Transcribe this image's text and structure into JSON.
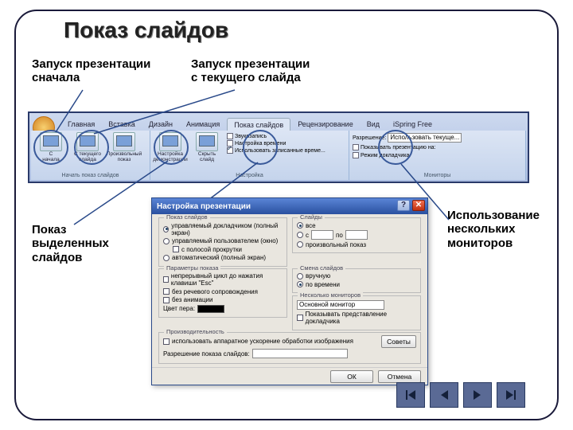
{
  "title": "Показ слайдов",
  "annotations": {
    "start_begin": "Запуск презентации\nсначала",
    "start_current": "Запуск презентации\nс текущего слайда",
    "custom_show": "Показ\nвыделенных\nслайдов",
    "monitors": "Использование\nнескольких\nмониторов"
  },
  "ribbon": {
    "tabs": [
      "Главная",
      "Вставка",
      "Дизайн",
      "Анимация",
      "Показ слайдов",
      "Рецензирование",
      "Вид",
      "iSpring Free"
    ],
    "active_tab": "Показ слайдов",
    "g_start_label": "Начать показ слайдов",
    "items_start": [
      {
        "label": "С\nначала"
      },
      {
        "label": "С текущего\nслайда"
      },
      {
        "label": "Произвольный\nпоказ"
      }
    ],
    "g_setup_label": "Настройка",
    "items_setup": [
      {
        "label": "Настройка\nдемонстрации"
      },
      {
        "label": "Скрыть\nслайд"
      }
    ],
    "opts_setup": [
      "Звукозапись",
      "Настройка времени",
      "Использовать записанные време..."
    ],
    "g_monitors_label": "Мониторы",
    "mon_res_label": "Разрешение:",
    "mon_res_value": "Использовать текуще...",
    "mon_opts": [
      "Показывать презентацию на:",
      "Режим докладчика"
    ]
  },
  "dialog": {
    "title": "Настройка презентации",
    "fs_show": "Показ слайдов",
    "show_opts": [
      "управляемый докладчиком (полный экран)",
      "управляемый пользователем (окно)",
      "с полосой прокрутки",
      "автоматический (полный экран)"
    ],
    "fs_slides": "Слайды",
    "slides_all": "все",
    "slides_from": "с",
    "slides_to": "по",
    "slides_custom": "произвольный показ",
    "fs_params": "Параметры показа",
    "params": [
      "непрерывный цикл до нажатия клавиши \"Esc\"",
      "без речевого сопровождения",
      "без анимации"
    ],
    "pen_label": "Цвет пера:",
    "fs_advance": "Смена слайдов",
    "advance_manual": "вручную",
    "advance_timing": "по времени",
    "fs_monitors": "Несколько мониторов",
    "mon_display": "Основной монитор",
    "mon_presenter": "Показывать представление докладчика",
    "fs_perf": "Производительность",
    "perf_hw": "использовать аппаратное ускорение обработки изображения",
    "perf_res": "Разрешение показа слайдов:",
    "tips": "Советы",
    "ok": "ОК",
    "cancel": "Отмена"
  }
}
